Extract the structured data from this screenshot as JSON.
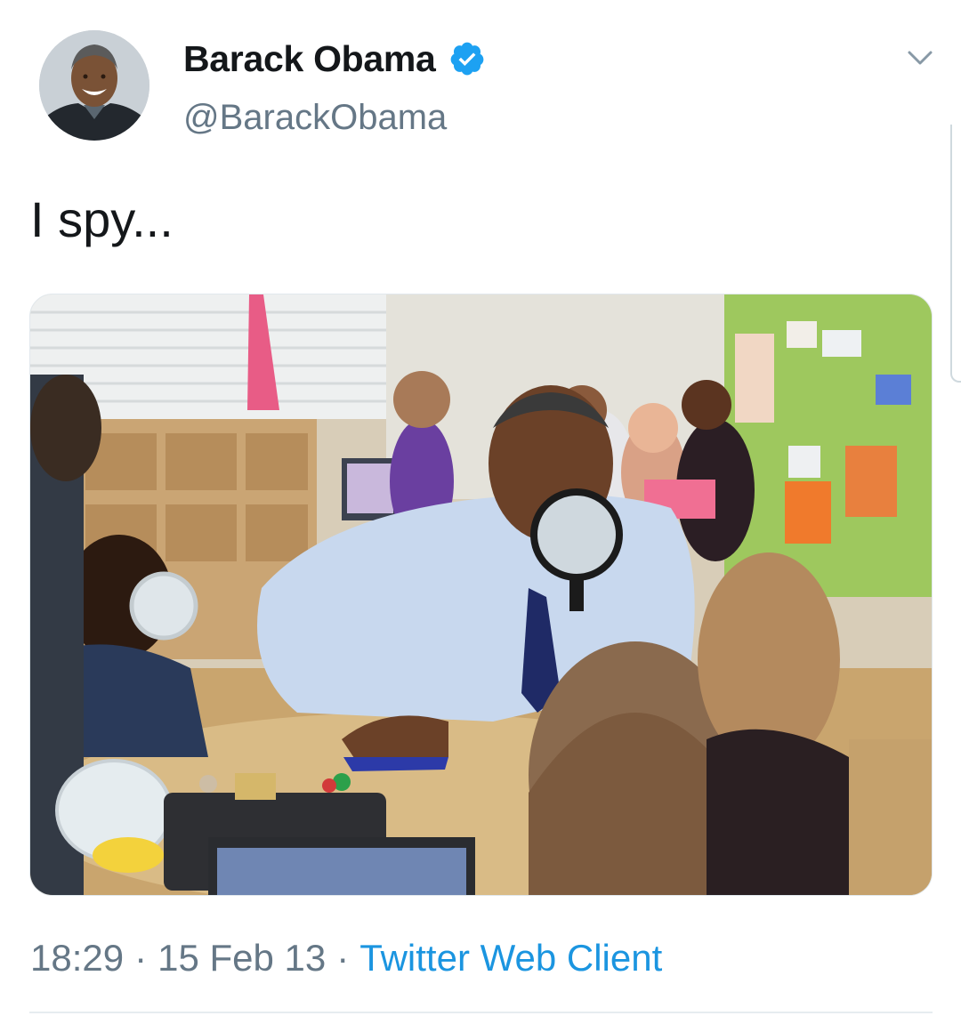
{
  "tweet": {
    "author": {
      "display_name": "Barack Obama",
      "handle": "@BarackObama",
      "verified": true,
      "verified_badge_color": "#1da1f2"
    },
    "text": "I spy...",
    "media": {
      "type": "photo",
      "icon": "photo"
    },
    "meta": {
      "time": "18:29",
      "separator": "·",
      "date": "15 Feb 13",
      "client": "Twitter Web Client"
    }
  },
  "colors": {
    "text_primary": "#14171a",
    "text_secondary": "#657786",
    "link": "#1b95e0",
    "divider": "#e6ecf0"
  },
  "icons": {
    "menu": "chevron-down-icon",
    "verified": "verified-badge-icon"
  }
}
